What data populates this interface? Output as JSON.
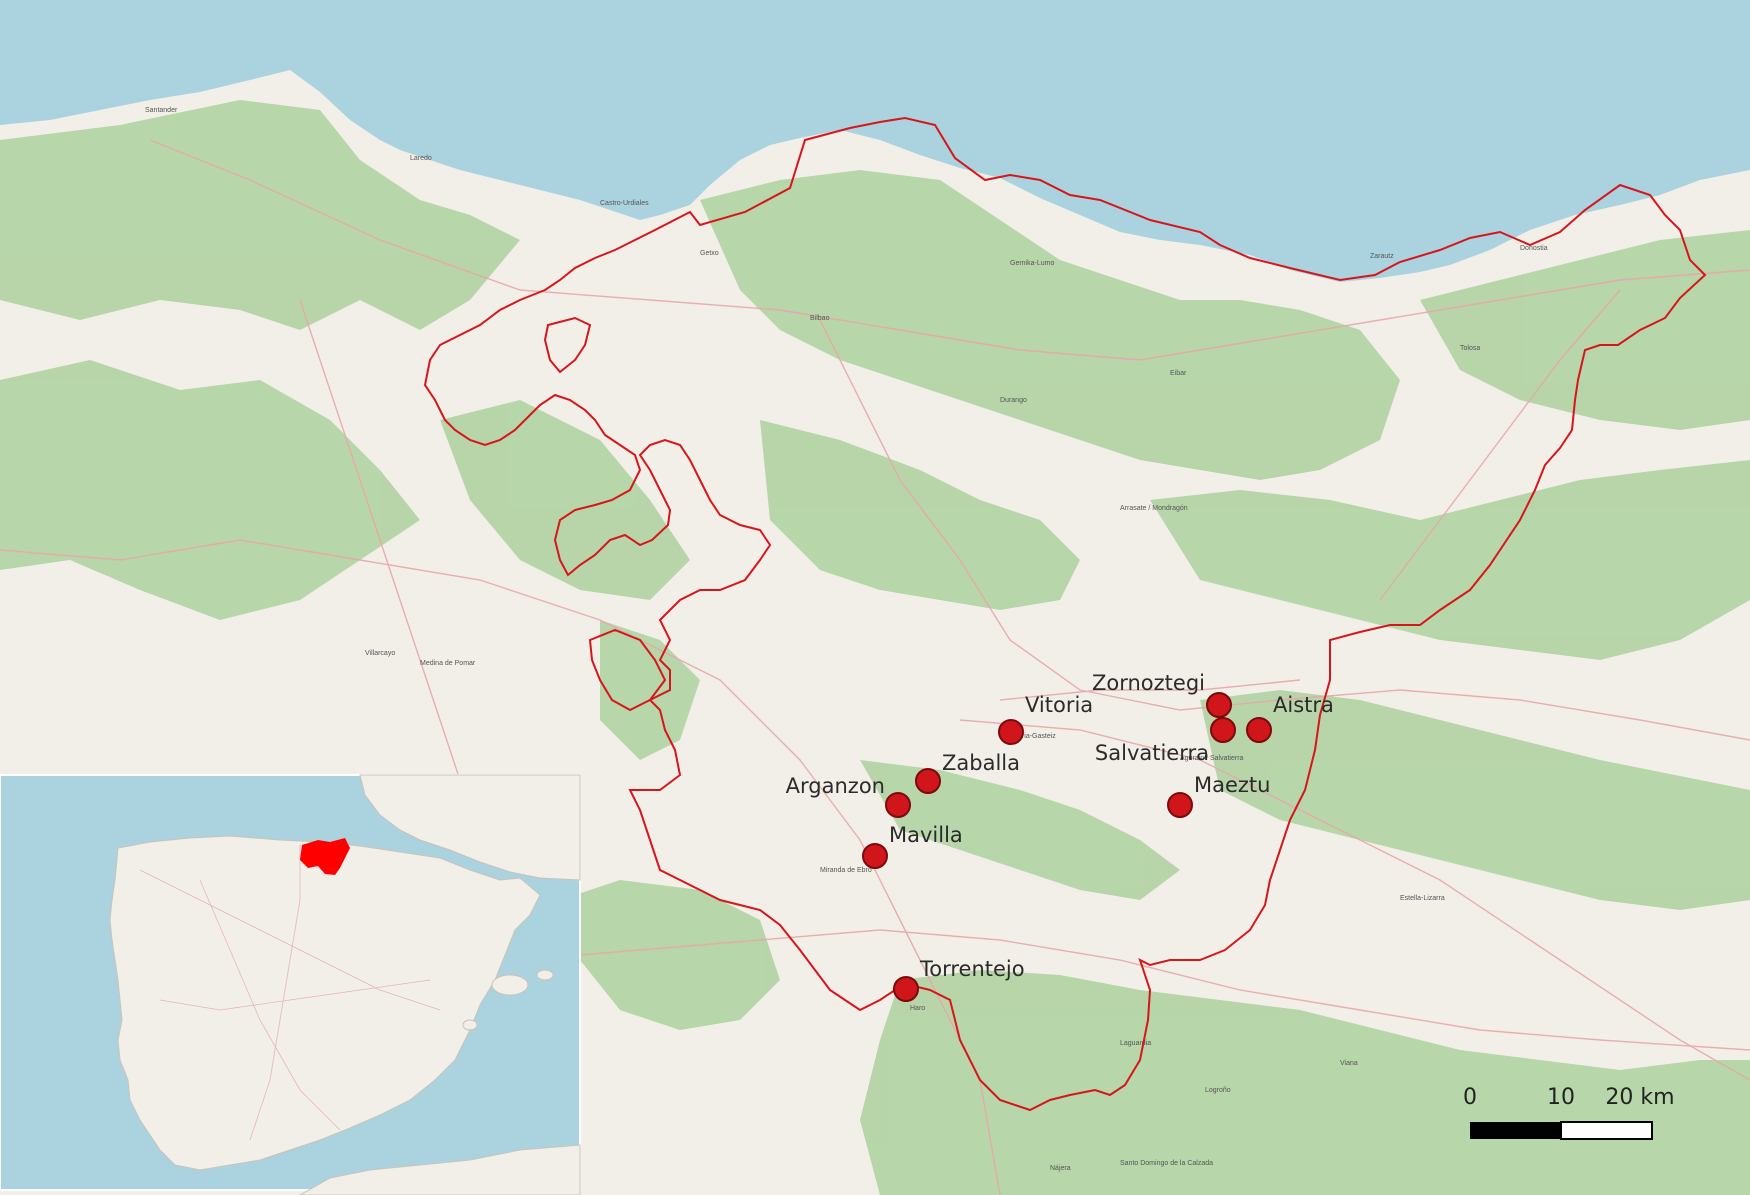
{
  "sites": [
    {
      "name": "Vitoria"
    },
    {
      "name": "Zornoztegi"
    },
    {
      "name": "Aistra"
    },
    {
      "name": "Salvatierra"
    },
    {
      "name": "Zaballa"
    },
    {
      "name": "Arganzon"
    },
    {
      "name": "Maeztu"
    },
    {
      "name": "Mavilla"
    },
    {
      "name": "Torrentejo"
    }
  ],
  "scale_bar": {
    "tick_0": "0",
    "tick_1": "10",
    "tick_2": "20 km"
  },
  "basemap_towns": [
    "Santander",
    "Bilbao",
    "Donostia",
    "Vitoria-Gasteiz",
    "Logroño",
    "Haro",
    "Miranda de Ebro",
    "Durango",
    "Arrasate / Mondragón",
    "Tolosa",
    "Zarautz",
    "Getxo",
    "Castro-Urdiales",
    "Laredo",
    "Santo Domingo de la Calzada",
    "Villarcayo",
    "Medina de Pomar",
    "Eibar",
    "Gernika-Lumo",
    "Estella-Lizarra",
    "Viana",
    "Nájera",
    "Agurain / Salvatierra",
    "Laguardia"
  ],
  "colors": {
    "sea": "#aad3df",
    "land": "#f2efe9",
    "forest": "#add19e",
    "boundary": "#d6161b",
    "site_fill": "#d0151b",
    "site_stroke": "#7a0a0c"
  },
  "inset": {
    "highlight_color": "#ff0000"
  }
}
